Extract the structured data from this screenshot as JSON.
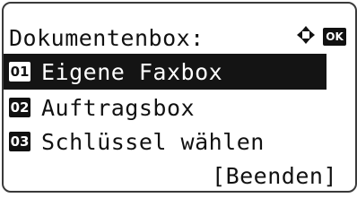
{
  "screen": {
    "title": "Dokumentenbox:",
    "icons": [
      "four-way-arrow-icon",
      "ok-icon"
    ],
    "ok_label": "OK"
  },
  "menu": {
    "items": [
      {
        "number": "01",
        "label": "Eigene Faxbox",
        "selected": true
      },
      {
        "number": "02",
        "label": "Auftragsbox",
        "selected": false
      },
      {
        "number": "03",
        "label": "Schlüssel wählen",
        "selected": false
      }
    ],
    "exit_label": "[Beenden]"
  }
}
